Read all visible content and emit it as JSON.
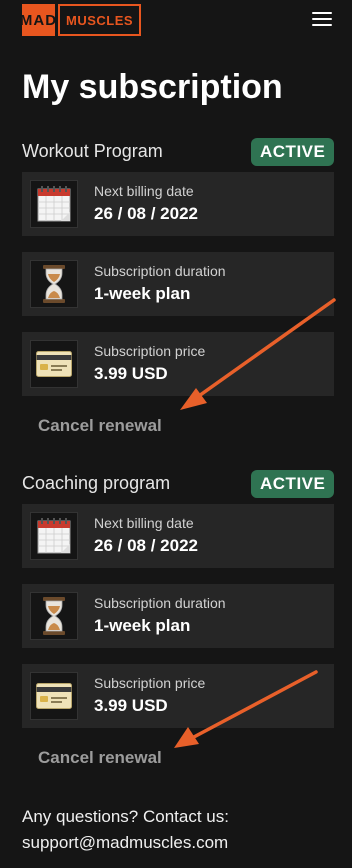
{
  "header": {
    "logo_part1": "MAD",
    "logo_part2": "MUSCLES"
  },
  "page_title": "My subscription",
  "sections": [
    {
      "title": "Workout Program",
      "status": "ACTIVE",
      "cards": [
        {
          "icon": "calendar-icon",
          "label": "Next billing date",
          "value": "26 / 08 / 2022"
        },
        {
          "icon": "hourglass-icon",
          "label": "Subscription duration",
          "value": "1-week plan"
        },
        {
          "icon": "credit-card-icon",
          "label": "Subscription price",
          "value": "3.99 USD"
        }
      ],
      "cancel_label": "Cancel renewal"
    },
    {
      "title": "Coaching program",
      "status": "ACTIVE",
      "cards": [
        {
          "icon": "calendar-icon",
          "label": "Next billing date",
          "value": "26 / 08 / 2022"
        },
        {
          "icon": "hourglass-icon",
          "label": "Subscription duration",
          "value": "1-week plan"
        },
        {
          "icon": "credit-card-icon",
          "label": "Subscription price",
          "value": "3.99 USD"
        }
      ],
      "cancel_label": "Cancel renewal"
    }
  ],
  "contact": {
    "line1": "Any questions? Contact us:",
    "line2": "support@madmuscles.com"
  },
  "colors": {
    "background": "#151515",
    "brand": "#e8561f",
    "badge": "#2f7352",
    "card": "#262626",
    "annotation_arrow": "#e8602a"
  }
}
